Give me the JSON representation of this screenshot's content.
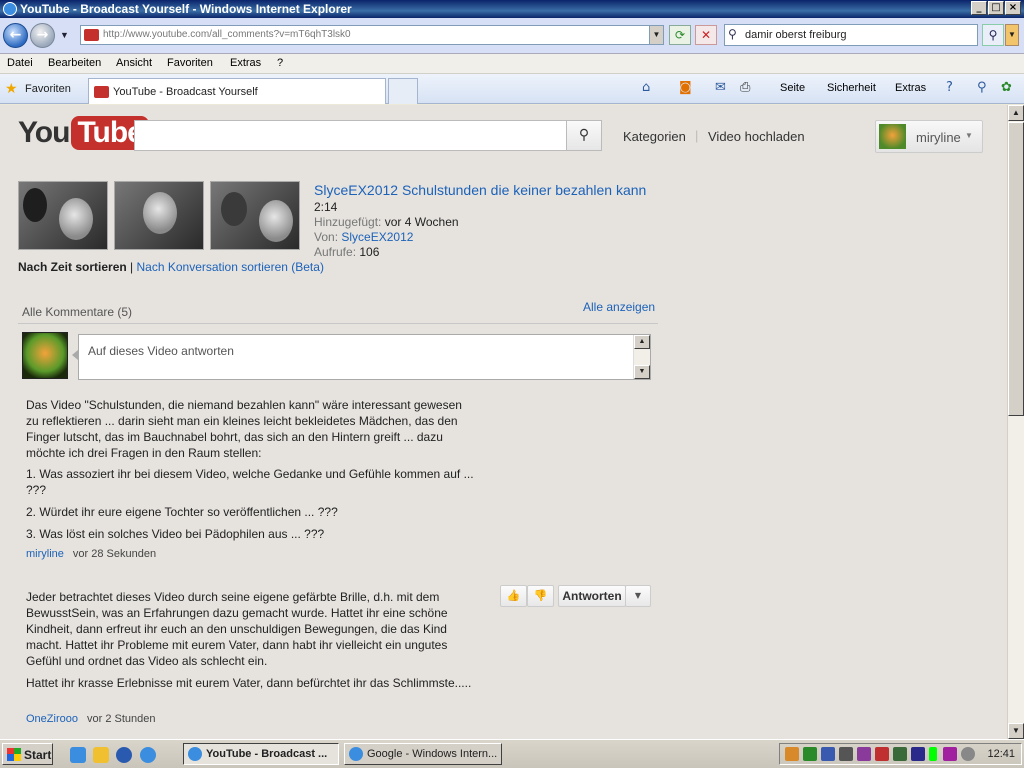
{
  "window": {
    "title": "YouTube - Broadcast Yourself - Windows Internet Explorer",
    "controls": [
      "_",
      "□",
      "×"
    ]
  },
  "address": {
    "url": "http://www.youtube.com/all_comments?v=mT6qhT3lsk0",
    "search_query": "damir oberst freiburg"
  },
  "menu": [
    "Datei",
    "Bearbeiten",
    "Ansicht",
    "Favoriten",
    "Extras",
    "?"
  ],
  "favbar": {
    "favorites_label": "Favoriten",
    "tab_title": "YouTube - Broadcast Yourself",
    "commands": [
      "Seite",
      "Sicherheit",
      "Extras"
    ]
  },
  "youtube": {
    "logo_you": "You",
    "logo_tube": "Tube",
    "nav": {
      "categories": "Kategorien",
      "separator": "|",
      "upload": "Video hochladen"
    },
    "username": "miryline",
    "video": {
      "title": "SlyceEX2012 Schulstunden die keiner bezahlen kann",
      "length": "2:14",
      "added_label": "Hinzugefügt:",
      "added_value": "vor 4 Wochen",
      "from_label": "Von:",
      "from_value": "SlyceEX2012",
      "views_label": "Aufrufe:",
      "views_value": "106"
    },
    "sort": {
      "by_time": "Nach Zeit sortieren",
      "separator": "|",
      "by_conversation": "Nach Konversation sortieren (Beta)"
    },
    "comments_header": "Alle Kommentare (5)",
    "show_all": "Alle anzeigen",
    "reply_placeholder": "Auf dieses Video antworten",
    "comments": [
      {
        "paragraphs": [
          "Das Video \"Schulstunden, die niemand bezahlen kann\" wäre interessant gewesen zu reflektieren ... darin sieht man ein kleines leicht bekleidetes Mädchen, das den Finger lutscht, das im Bauchnabel bohrt, das sich an den Hintern greift ... dazu möchte ich drei Fragen in den Raum stellen:",
          "1. Was assoziert ihr bei diesem Video, welche Gedanke und Gefühle kommen auf ... ???",
          "2. Würdet ihr eure eigene Tochter so veröffentlichen ... ???",
          "3. Was löst ein solches Video bei Pädophilen aus ... ???"
        ],
        "user": "miryline",
        "time": "vor 28 Sekunden"
      },
      {
        "paragraphs": [
          "Jeder betrachtet dieses Video durch seine eigene gefärbte Brille, d.h. mit dem BewusstSein, was an Erfahrungen dazu gemacht wurde. Hattet ihr eine schöne Kindheit, dann erfreut ihr euch an den unschuldigen Bewegungen, die das Kind macht. Hattet ihr Probleme mit eurem Vater, dann habt ihr vielleicht ein ungutes Gefühl und ordnet das Video als schlecht ein.",
          "Hattet ihr krasse Erlebnisse mit eurem Vater, dann befürchtet ihr das Schlimmste....."
        ],
        "user": "OneZirooo",
        "time": "vor 2 Stunden",
        "reply_label": "Antworten"
      }
    ]
  },
  "taskbar": {
    "start": "Start",
    "tasks": [
      "YouTube - Broadcast ...",
      "Google - Windows Intern..."
    ],
    "clock": "12:41"
  }
}
